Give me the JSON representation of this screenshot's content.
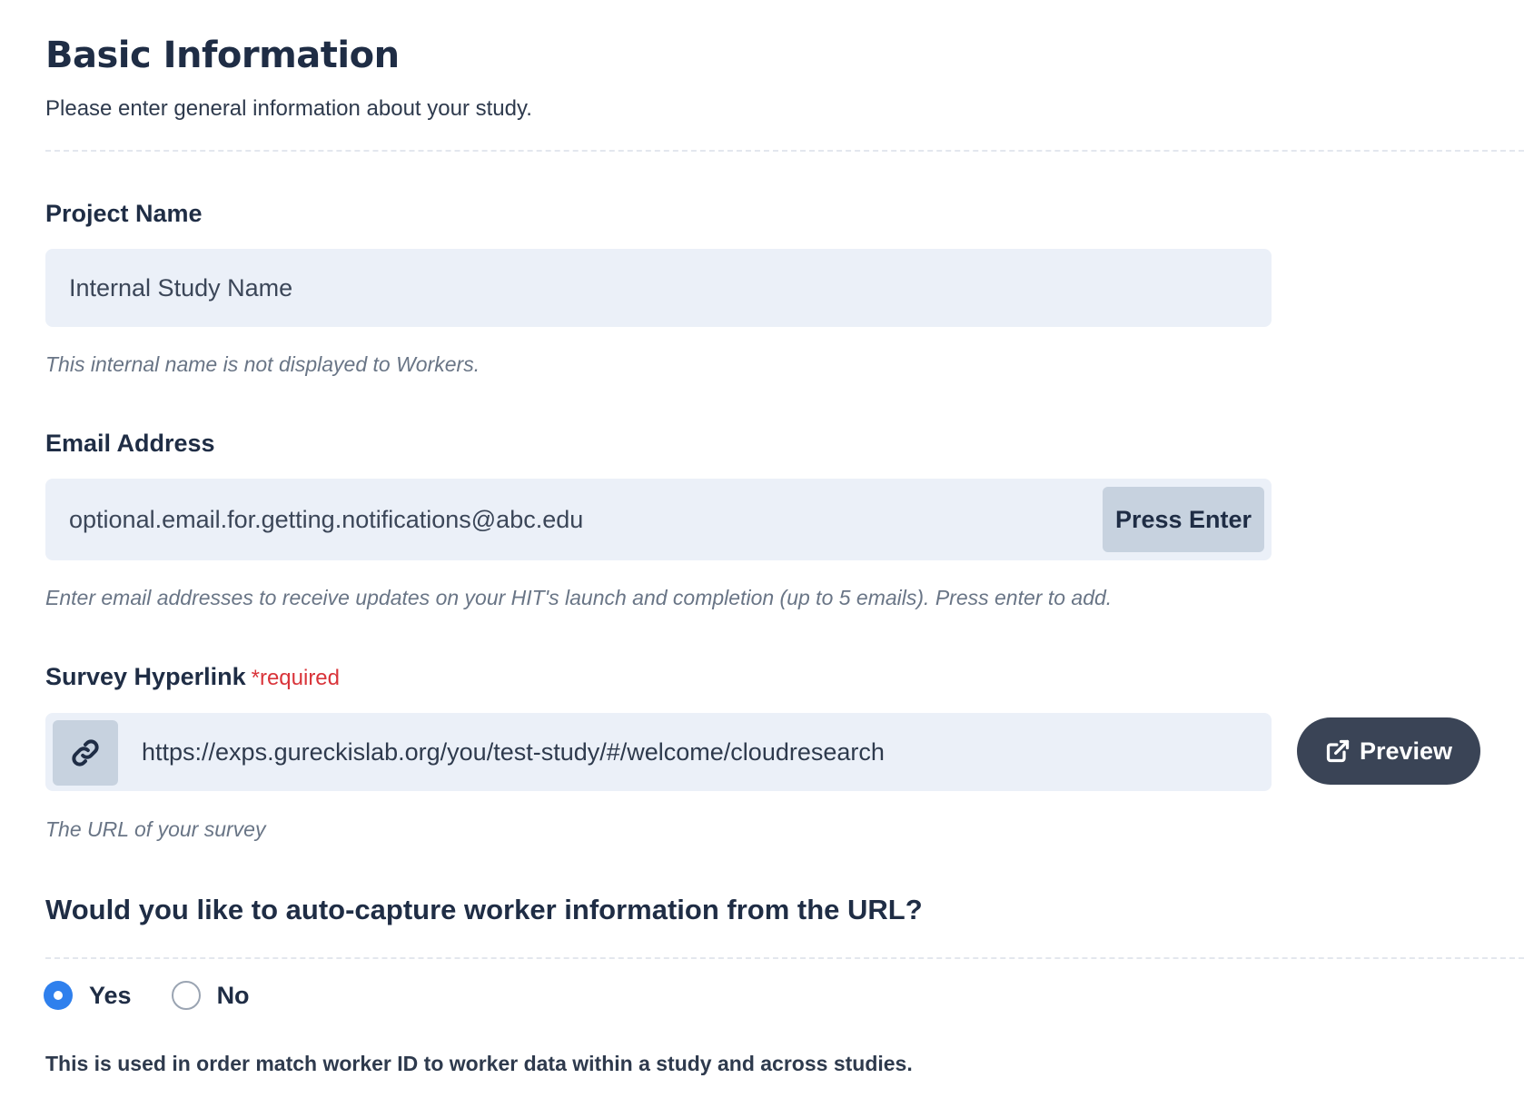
{
  "section": {
    "title": "Basic Information",
    "description": "Please enter general information about your study."
  },
  "project_name": {
    "label": "Project Name",
    "placeholder": "Internal Study Name",
    "help": "This internal name is not displayed to Workers."
  },
  "email": {
    "label": "Email Address",
    "placeholder": "optional.email.for.getting.notifications@abc.edu",
    "button_label": "Press Enter",
    "help": "Enter email addresses to receive updates on your HIT's launch and completion (up to 5 emails). Press enter to add."
  },
  "survey": {
    "label": "Survey Hyperlink",
    "required_text": "*required",
    "value": "https://exps.gureckislab.org/you/test-study/#/welcome/cloudresearch",
    "preview_label": "Preview",
    "help": "The URL of your survey",
    "link_icon": "link-icon",
    "preview_icon": "external-link-icon"
  },
  "autocapture": {
    "question": "Would you like to auto-capture worker information from the URL?",
    "options": [
      {
        "label": "Yes",
        "selected": true
      },
      {
        "label": "No",
        "selected": false
      }
    ],
    "note": "This is used in order match worker ID to worker data within a study and across studies."
  },
  "colors": {
    "accent": "#2f80ed",
    "heading": "#1f2d45",
    "input_bg": "#ebf0f8",
    "required": "#d9343a",
    "preview_bg": "#3a4456"
  }
}
